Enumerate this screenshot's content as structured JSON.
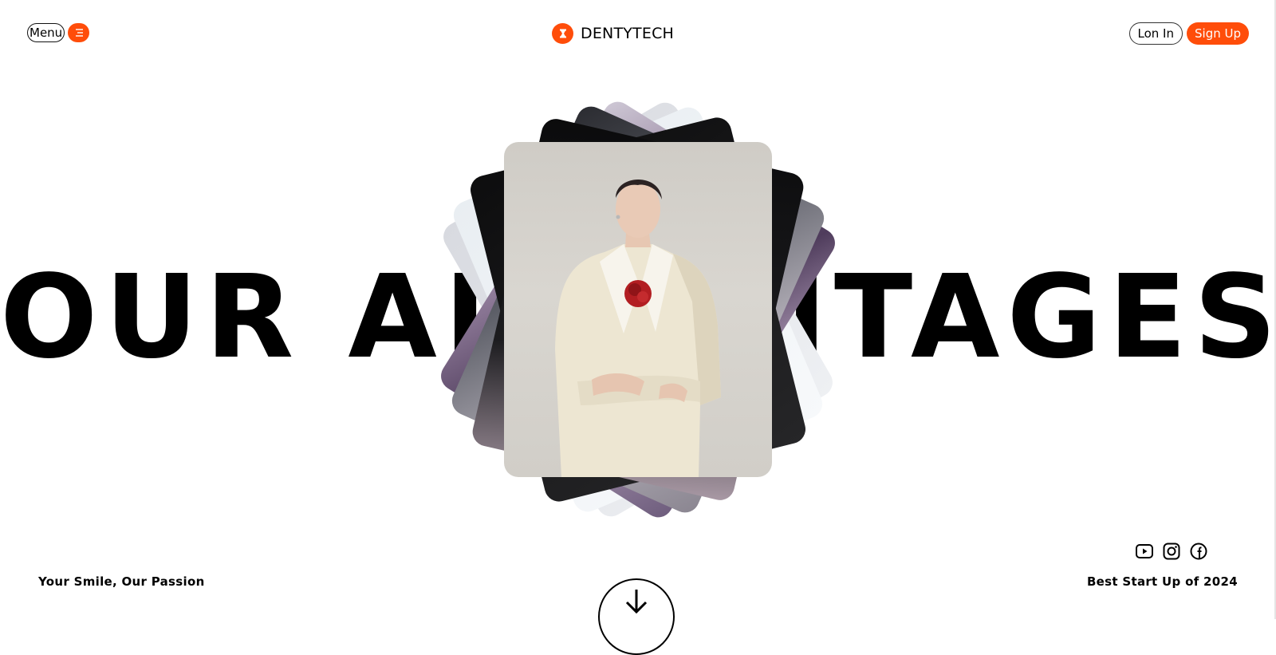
{
  "header": {
    "menu_label": "Menu",
    "menu_icon": "hamburger-icon",
    "brand_icon": "tooth-logo-icon",
    "brand_name": "DENTYTECH",
    "login_label": "Lon In",
    "signup_label": "Sign Up"
  },
  "hero": {
    "title": "OUR ADVANTAGES",
    "image_stack": [
      "woman-in-cream-suit-photo",
      "purple-fabric-photo",
      "dark-photo",
      "light-photo"
    ]
  },
  "footer": {
    "tagline_left": "Your Smile, Our Passion",
    "tagline_right": "Best Start Up of 2024",
    "social_icons": [
      "youtube-icon",
      "instagram-icon",
      "facebook-icon"
    ],
    "scroll_icon": "arrow-down-icon"
  },
  "colors": {
    "accent": "#ff4d0a",
    "text": "#000000",
    "background": "#ffffff"
  }
}
